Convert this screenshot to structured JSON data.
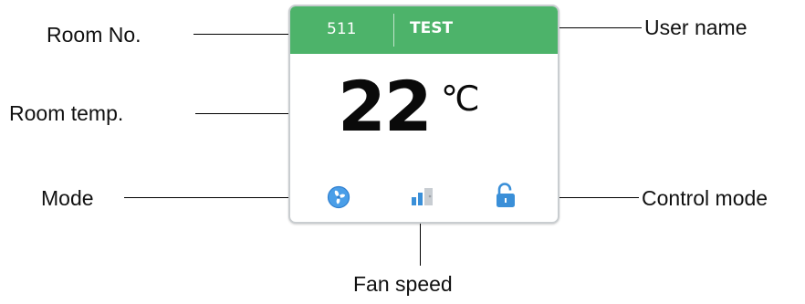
{
  "callouts": {
    "room_no": "Room No.",
    "user_name": "User name",
    "room_temp": "Room temp.",
    "mode": "Mode",
    "control_mode": "Control mode",
    "fan_speed": "Fan speed"
  },
  "card": {
    "room_number": "511",
    "user": "TEST",
    "temperature": "22",
    "unit": "℃",
    "header_color": "#4db36a",
    "icons": {
      "mode": "fan-mode-icon",
      "fan_speed": "fan-speed-bars-icon",
      "control": "unlocked-padlock-icon"
    }
  }
}
